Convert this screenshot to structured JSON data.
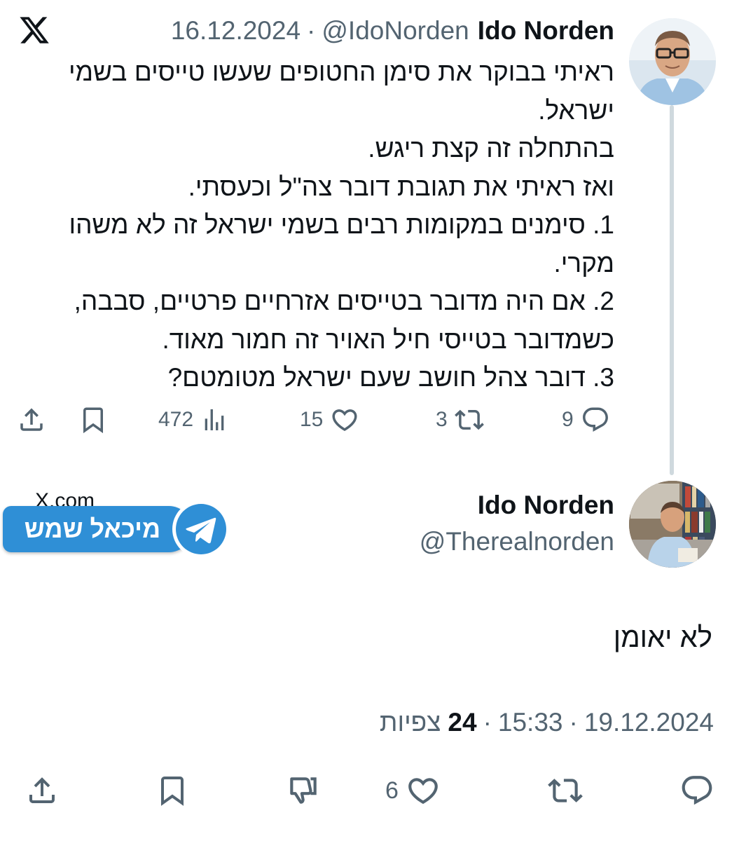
{
  "parent_tweet": {
    "author_name": "Ido Norden",
    "handle": "@IdoNorden",
    "separator": "·",
    "date": "16.12.2024",
    "body_lines": [
      "ראיתי בבוקר את סימן החטופים שעשו טייסים בשמי ישראל.",
      "בהתחלה זה קצת ריגש.",
      "ואז ראיתי את תגובת דובר צה\"ל וכעסתי.",
      "1. סימנים במקומות רבים בשמי ישראל זה לא משהו מקרי.",
      "2. אם היה מדובר בטייסים אזרחיים פרטיים, סבבה, כשמדובר בטייסי חיל האויר זה חמור מאוד.",
      "3. דובר צהל חושב שעם ישראל מטומטם?"
    ],
    "actions": {
      "replies": "9",
      "retweets": "3",
      "likes": "15",
      "views": "472"
    }
  },
  "reply_tweet": {
    "author_name": "Ido Norden",
    "handle": "@Therealnorden",
    "text": "לא יאומן",
    "date": "19.12.2024",
    "time": "15:33",
    "separator": "·",
    "views_count": "24",
    "views_label": "צפיות",
    "actions": {
      "likes": "6"
    }
  },
  "watermark": {
    "ghost_text": "X.com",
    "label": "מיכאל שמש"
  },
  "icons": {
    "logo": "x-logo-icon",
    "reply": "reply-icon",
    "retweet": "retweet-icon",
    "like": "heart-icon",
    "views": "views-icon",
    "bookmark": "bookmark-icon",
    "share": "share-icon",
    "dislike": "thumbs-down-icon",
    "telegram": "telegram-icon"
  },
  "colors": {
    "text": "#0f1419",
    "secondary": "#536471",
    "thread_line": "#cfd9de",
    "telegram_blue": "#2f8fd6"
  }
}
